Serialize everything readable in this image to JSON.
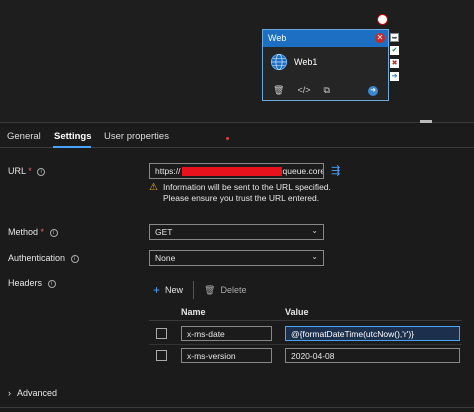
{
  "activity": {
    "type": "Web",
    "name": "Web1"
  },
  "tabs": [
    {
      "label": "General"
    },
    {
      "label": "Settings"
    },
    {
      "label": "User properties"
    }
  ],
  "url": {
    "label": "URL",
    "required": "*",
    "value_prefix": "https://",
    "value_suffix": "queue.core....",
    "warning": "Information will be sent to the URL specified. Please ensure you trust the URL entered."
  },
  "method": {
    "label": "Method",
    "required": "*",
    "value": "GET"
  },
  "authentication": {
    "label": "Authentication",
    "value": "None"
  },
  "headers": {
    "label": "Headers",
    "new_label": "New",
    "delete_label": "Delete",
    "col_name": "Name",
    "col_value": "Value",
    "rows": [
      {
        "name": "x-ms-date",
        "value": "@{formatDateTime(utcNow(),'r')}"
      },
      {
        "name": "x-ms-version",
        "value": "2020-04-08"
      }
    ]
  },
  "advanced": {
    "label": "Advanced"
  },
  "colors": {
    "accent": "#4aa3ff",
    "activity_header": "#1d6fc4",
    "warning": "#f0b400",
    "redaction": "#e8121d"
  }
}
